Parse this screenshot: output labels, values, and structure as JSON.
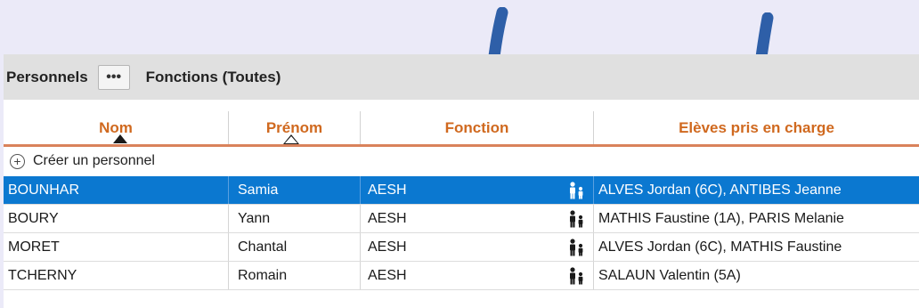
{
  "toolbar": {
    "title": "Personnels",
    "more_label": "•••",
    "filter_label": "Fonctions (Toutes)"
  },
  "columns": {
    "nom": "Nom",
    "prenom": "Prénom",
    "fonction": "Fonction",
    "eleves": "Elèves pris en charge"
  },
  "create": {
    "label": "Créer un personnel",
    "icon": "plus-circle-icon"
  },
  "rows": [
    {
      "nom": "BOUNHAR",
      "prenom": "Samia",
      "fonction": "AESH",
      "eleves": "ALVES Jordan (6C), ANTIBES Jeanne",
      "selected": true
    },
    {
      "nom": "BOURY",
      "prenom": "Yann",
      "fonction": "AESH",
      "eleves": "MATHIS Faustine (1A), PARIS Melanie"
    },
    {
      "nom": "MORET",
      "prenom": "Chantal",
      "fonction": "AESH",
      "eleves": "ALVES Jordan (6C), MATHIS Faustine"
    },
    {
      "nom": "TCHERNY",
      "prenom": "Romain",
      "fonction": "AESH",
      "eleves": "SALAUN Valentin (5A)"
    }
  ],
  "colors": {
    "background": "#ebeaf8",
    "header_text": "#d0691f",
    "selected_row": "#0b78d0",
    "arrow": "#2e5fa8"
  }
}
